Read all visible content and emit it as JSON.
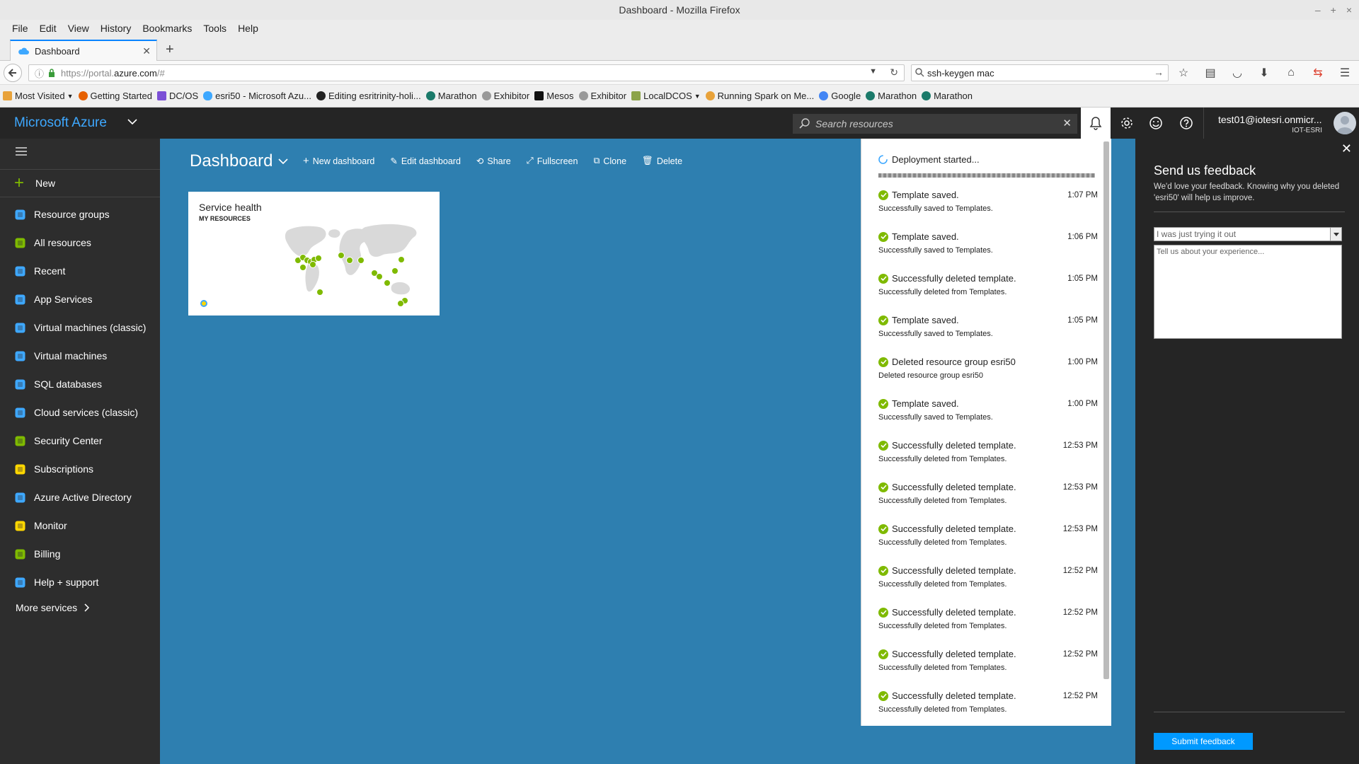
{
  "window": {
    "title": "Dashboard - Mozilla Firefox"
  },
  "menu": [
    "File",
    "Edit",
    "View",
    "History",
    "Bookmarks",
    "Tools",
    "Help"
  ],
  "tab": {
    "label": "Dashboard"
  },
  "url": {
    "prefix": "https://portal.",
    "host": "azure.com",
    "suffix": "/#"
  },
  "search": {
    "value": "ssh-keygen mac"
  },
  "bookmarks": [
    "Most Visited",
    "Getting Started",
    "DC/OS",
    "esri50 - Microsoft Azu...",
    "Editing esritrinity-holi...",
    "Marathon",
    "Exhibitor",
    "Mesos",
    "Exhibitor",
    "LocalDCOS",
    "Running Spark on Me...",
    "Google",
    "Marathon",
    "Marathon"
  ],
  "azure": {
    "brand": "Microsoft Azure",
    "search_placeholder": "Search resources",
    "user_email": "test01@iotesri.onmicr...",
    "user_tenant": "IOT-ESRI"
  },
  "sidebar": {
    "new_label": "New",
    "items": [
      {
        "label": "Resource groups",
        "icon": "resource-groups-icon",
        "color": "#3ea8ff"
      },
      {
        "label": "All resources",
        "icon": "all-resources-icon",
        "color": "#7fba00"
      },
      {
        "label": "Recent",
        "icon": "clock-icon",
        "color": "#3ea8ff"
      },
      {
        "label": "App Services",
        "icon": "app-services-icon",
        "color": "#3ea8ff"
      },
      {
        "label": "Virtual machines (classic)",
        "icon": "vm-classic-icon",
        "color": "#3ea8ff"
      },
      {
        "label": "Virtual machines",
        "icon": "vm-icon",
        "color": "#3ea8ff"
      },
      {
        "label": "SQL databases",
        "icon": "sql-icon",
        "color": "#3ea8ff"
      },
      {
        "label": "Cloud services (classic)",
        "icon": "cloud-icon",
        "color": "#3ea8ff"
      },
      {
        "label": "Security Center",
        "icon": "shield-icon",
        "color": "#7fba00"
      },
      {
        "label": "Subscriptions",
        "icon": "key-icon",
        "color": "#ffd700"
      },
      {
        "label": "Azure Active Directory",
        "icon": "aad-icon",
        "color": "#3ea8ff"
      },
      {
        "label": "Monitor",
        "icon": "monitor-icon",
        "color": "#ffd700"
      },
      {
        "label": "Billing",
        "icon": "billing-icon",
        "color": "#7fba00"
      },
      {
        "label": "Help + support",
        "icon": "help-support-icon",
        "color": "#3ea8ff"
      }
    ],
    "more_label": "More services"
  },
  "dashboard": {
    "title": "Dashboard",
    "toolbar": [
      "New dashboard",
      "Edit dashboard",
      "Share",
      "Fullscreen",
      "Clone",
      "Delete"
    ],
    "tile": {
      "title": "Service health",
      "subtitle": "MY RESOURCES"
    }
  },
  "notifications": {
    "header": "Deployment started...",
    "items": [
      {
        "title": "Template saved.",
        "subtitle": "Successfully saved to Templates.",
        "time": "1:07 PM"
      },
      {
        "title": "Template saved.",
        "subtitle": "Successfully saved to Templates.",
        "time": "1:06 PM"
      },
      {
        "title": "Successfully deleted template.",
        "subtitle": "Successfully deleted from Templates.",
        "time": "1:05 PM"
      },
      {
        "title": "Template saved.",
        "subtitle": "Successfully saved to Templates.",
        "time": "1:05 PM"
      },
      {
        "title": "Deleted resource group esri50",
        "subtitle": "Deleted resource group esri50",
        "time": "1:00 PM"
      },
      {
        "title": "Template saved.",
        "subtitle": "Successfully saved to Templates.",
        "time": "1:00 PM"
      },
      {
        "title": "Successfully deleted template.",
        "subtitle": "Successfully deleted from Templates.",
        "time": "12:53 PM"
      },
      {
        "title": "Successfully deleted template.",
        "subtitle": "Successfully deleted from Templates.",
        "time": "12:53 PM"
      },
      {
        "title": "Successfully deleted template.",
        "subtitle": "Successfully deleted from Templates.",
        "time": "12:53 PM"
      },
      {
        "title": "Successfully deleted template.",
        "subtitle": "Successfully deleted from Templates.",
        "time": "12:52 PM"
      },
      {
        "title": "Successfully deleted template.",
        "subtitle": "Successfully deleted from Templates.",
        "time": "12:52 PM"
      },
      {
        "title": "Successfully deleted template.",
        "subtitle": "Successfully deleted from Templates.",
        "time": "12:52 PM"
      },
      {
        "title": "Successfully deleted template.",
        "subtitle": "Successfully deleted from Templates.",
        "time": "12:52 PM"
      }
    ]
  },
  "feedback": {
    "title": "Send us feedback",
    "description": "We'd love your feedback. Knowing why you deleted 'esri50' will help us improve.",
    "reason_selected": "I was just trying it out",
    "textarea_placeholder": "Tell us about your experience...",
    "submit_label": "Submit feedback"
  }
}
